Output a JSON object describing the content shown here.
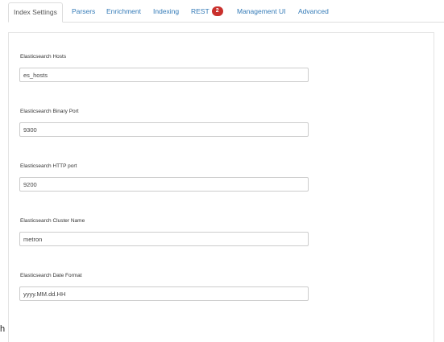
{
  "tabs": [
    {
      "label": "Index Settings",
      "active": true
    },
    {
      "label": "Parsers"
    },
    {
      "label": "Enrichment"
    },
    {
      "label": "Indexing"
    },
    {
      "label": "REST",
      "badge": "2"
    },
    {
      "label": "Management UI"
    },
    {
      "label": "Advanced"
    }
  ],
  "fields": [
    {
      "label": "Elasticsearch Hosts",
      "value": "es_hosts"
    },
    {
      "label": "Elasticsearch Binary Port",
      "value": "9300"
    },
    {
      "label": "Elasticsearch HTTP port",
      "value": "9200"
    },
    {
      "label": "Elasticsearch Cluster Name",
      "value": "metron"
    },
    {
      "label": "Elasticsearch Date Format",
      "value": "yyyy.MM.dd.HH"
    }
  ],
  "colors": {
    "link": "#337ab7",
    "badge": "#c9302c"
  },
  "stray_text": "h"
}
